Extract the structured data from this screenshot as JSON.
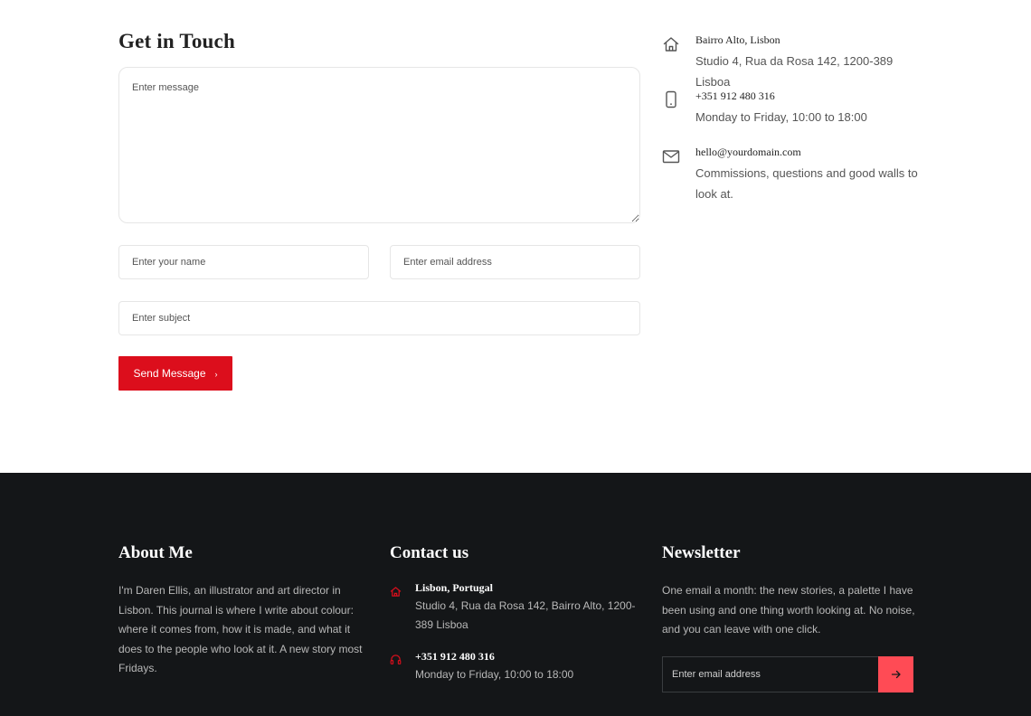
{
  "contact": {
    "title": "Get in Touch",
    "message_placeholder": "Enter message",
    "name_placeholder": "Enter your name",
    "email_placeholder": "Enter email address",
    "subject_placeholder": "Enter subject",
    "send_label": "Send Message",
    "send_icon": "chevron-right-icon",
    "button_color": "#dc0e1c",
    "info": [
      {
        "icon": "home-icon",
        "heading": "Bairro Alto, Lisbon",
        "sub": "Studio 4, Rua da Rosa 142, 1200-389 Lisboa"
      },
      {
        "icon": "phone-icon",
        "heading": "+351 912 480 316",
        "sub": "Monday to Friday, 10:00 to 18:00"
      },
      {
        "icon": "mail-icon",
        "heading": "hello@yourdomain.com",
        "sub": "Commissions, questions and good walls to look at."
      }
    ]
  },
  "footer": {
    "background": "#141618",
    "about": {
      "title": "About Me",
      "text": "I'm Daren Ellis, an illustrator and art director in Lisbon. This journal is where I write about colour: where it comes from, how it is made, and what it does to the people who look at it. A new story most Fridays."
    },
    "contact": {
      "title": "Contact us",
      "accent": "#dc0e1c",
      "items": [
        {
          "icon": "home-icon",
          "heading": "Lisbon, Portugal",
          "sub": "Studio 4, Rua da Rosa 142, Bairro Alto, 1200-389 Lisboa"
        },
        {
          "icon": "headphones-icon",
          "heading": "+351 912 480 316",
          "sub": "Monday to Friday, 10:00 to 18:00"
        }
      ]
    },
    "newsletter": {
      "title": "Newsletter",
      "text": "One email a month: the new stories, a palette I have been using and one thing worth looking at. No noise, and you can leave with one click.",
      "email_placeholder": "Enter email address",
      "submit_icon": "arrow-right-icon",
      "button_color": "#ff4b55"
    }
  }
}
